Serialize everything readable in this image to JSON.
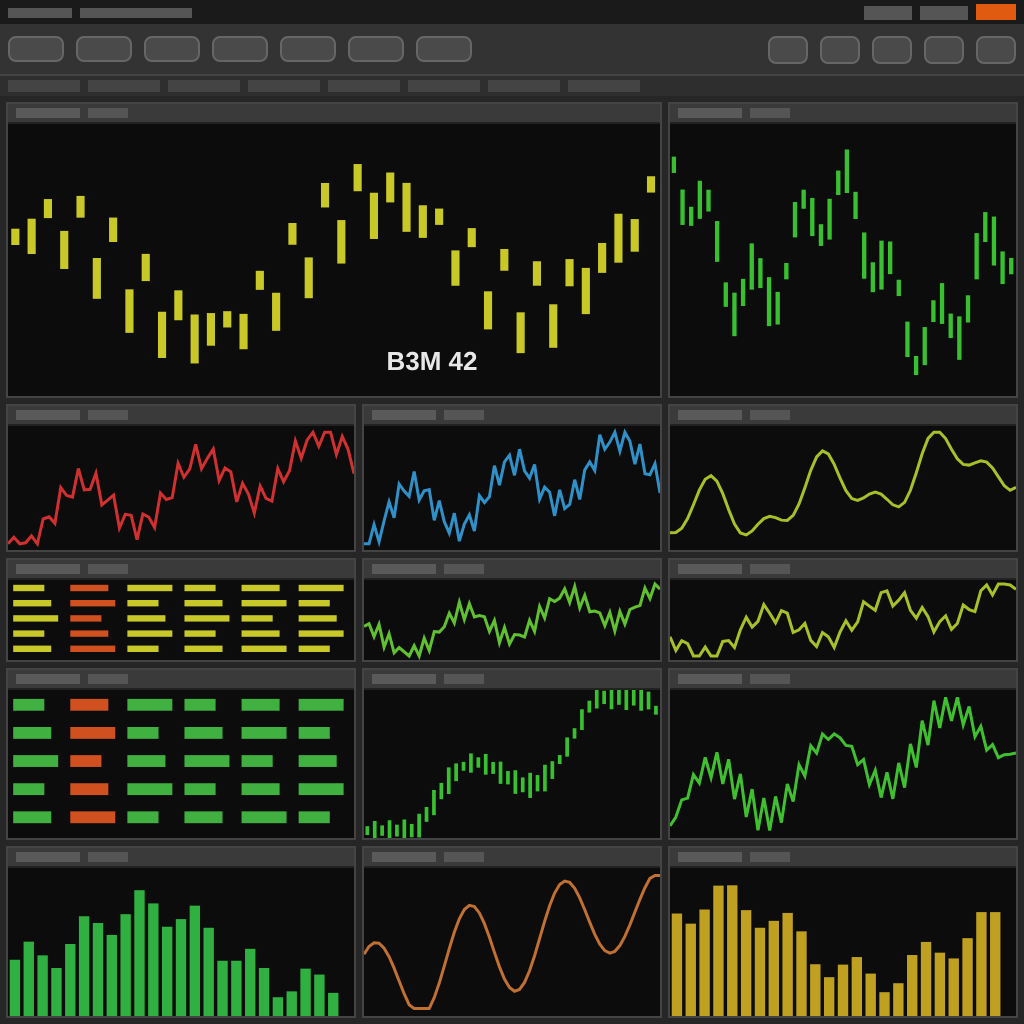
{
  "panels": [
    {
      "kind": "candles",
      "color": "#c8c828",
      "label": "B3M 42"
    },
    {
      "kind": "candles",
      "color": "#38c030"
    },
    {
      "kind": "line",
      "color": "#d03030"
    },
    {
      "kind": "line",
      "color": "#3090c8"
    },
    {
      "kind": "line",
      "color": "#a8c028"
    },
    {
      "kind": "readout",
      "color": "#c8c828"
    },
    {
      "kind": "line",
      "color": "#60c030"
    },
    {
      "kind": "line",
      "color": "#a8c028"
    },
    {
      "kind": "readout",
      "color": "#40b040"
    },
    {
      "kind": "candles",
      "color": "#38c030"
    },
    {
      "kind": "line",
      "color": "#40c030"
    },
    {
      "kind": "bars",
      "color": "#30b040"
    },
    {
      "kind": "line",
      "color": "#c07030"
    },
    {
      "kind": "bars",
      "color": "#c0a020"
    }
  ]
}
